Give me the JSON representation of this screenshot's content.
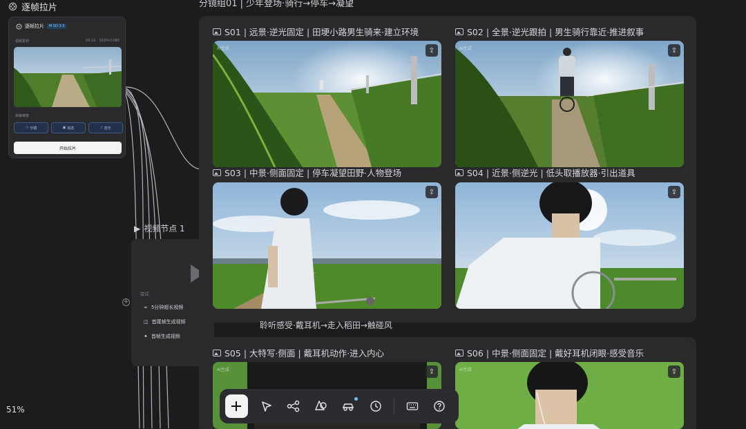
{
  "app": {
    "title": "逐帧拉片"
  },
  "node_card": {
    "title": "逐帧拉片",
    "version": "M SD 3.5",
    "material_label": "视频素材",
    "material_meta": "00:12 · 1920×1080",
    "section_label": "拆解维度",
    "chips": [
      "分镜",
      "动态",
      "音乐"
    ],
    "start_button": "开始拉片"
  },
  "video_node": {
    "title": "视频节点 1",
    "try_label": "尝试:",
    "options": [
      "5分钟超长视频",
      "首尾帧生成视频",
      "首帧生成视频"
    ]
  },
  "group1": {
    "title": "分镜组01 | 少年登场·骑行→停车→凝望",
    "shots": [
      {
        "label": "S01 | 远景·逆光固定 | 田埂小路男生骑来·建立环境"
      },
      {
        "label": "S02 | 全景·逆光跟拍 | 男生骑行靠近·推进叙事"
      },
      {
        "label": "S03 | 中景·侧面固定 | 停车凝望田野·人物登场"
      },
      {
        "label": "S04 | 近景·侧逆光 | 低头取播放器·引出道具"
      }
    ]
  },
  "group2": {
    "title": "聆听感受·戴耳机→走入稻田→触碰风",
    "shots": [
      {
        "label": "S05 | 大特写·侧面 | 戴耳机动作·进入内心"
      },
      {
        "label": "S06 | 中景·侧面固定 | 戴好耳机闭眼·感受音乐"
      }
    ]
  },
  "watermark": "AI生成",
  "zoom": "51%",
  "toolbar": {
    "items": [
      "add-icon",
      "select-pointer-icon",
      "nodes-icon",
      "shapes-icon",
      "car-asset-icon",
      "history-icon",
      "keyboard-icon",
      "help-icon"
    ]
  }
}
